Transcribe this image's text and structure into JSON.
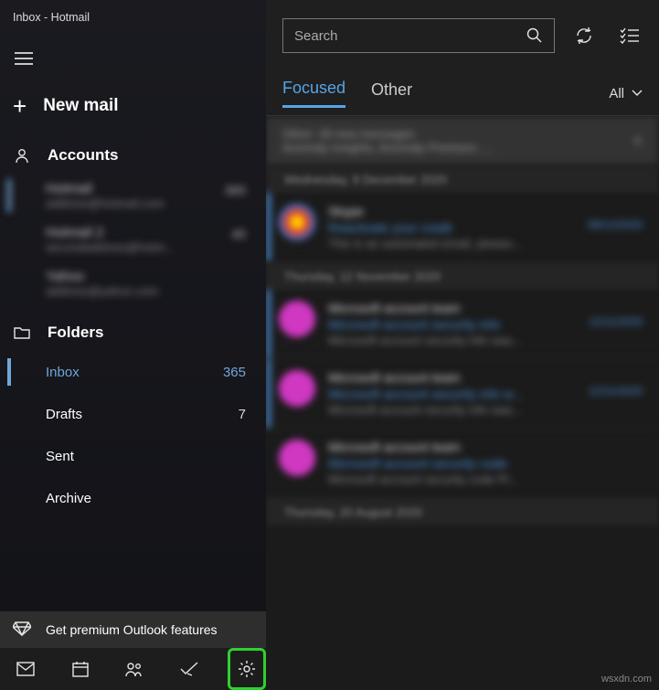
{
  "window": {
    "title": "Inbox - Hotmail"
  },
  "sidebar": {
    "new_mail": "New mail",
    "accounts_label": "Accounts",
    "accounts": [
      {
        "name": "Hotmail",
        "email": "address@hotmail.com",
        "count": "365"
      },
      {
        "name": "Hotmail 2",
        "email": "secondaddress@hotm...",
        "count": "45"
      },
      {
        "name": "Yahoo",
        "email": "address@yahoo.com",
        "count": ""
      }
    ],
    "folders_label": "Folders",
    "folders": [
      {
        "name": "Inbox",
        "count": "365",
        "selected": true
      },
      {
        "name": "Drafts",
        "count": "7",
        "selected": false
      },
      {
        "name": "Sent",
        "count": "",
        "selected": false
      },
      {
        "name": "Archive",
        "count": "",
        "selected": false
      }
    ],
    "premium": "Get premium Outlook features"
  },
  "search": {
    "placeholder": "Search"
  },
  "tabs": {
    "focused": "Focused",
    "other": "Other",
    "all": "All"
  },
  "messages": {
    "banner": {
      "line1": "Other: 28 new messages",
      "line2": "Anomaly Insights, Anomaly Premium, ..."
    },
    "groups": [
      {
        "header": "Wednesday, 9 December 2020",
        "items": [
          {
            "avatar": "skype",
            "sender": "Skype",
            "subject": "Reactivate your credit",
            "preview": "This is an automated email, please...",
            "date": "09/12/2020"
          }
        ]
      },
      {
        "header": "Thursday, 12 November 2020",
        "items": [
          {
            "avatar": "m",
            "sender": "Microsoft account team",
            "subject": "Microsoft account security info",
            "preview": "Microsoft account security info was...",
            "date": "12/11/2020"
          },
          {
            "avatar": "m",
            "sender": "Microsoft account team",
            "subject": "Microsoft account security info w...",
            "preview": "Microsoft account security info was...",
            "date": "12/11/2020"
          },
          {
            "avatar": "m",
            "sender": "Microsoft account team",
            "subject": "Microsoft account security code",
            "preview": "Microsoft account security code Pl...",
            "date": ""
          }
        ]
      },
      {
        "header": "Thursday, 20 August 2020",
        "items": []
      }
    ]
  },
  "watermark": "wsxdn.com"
}
